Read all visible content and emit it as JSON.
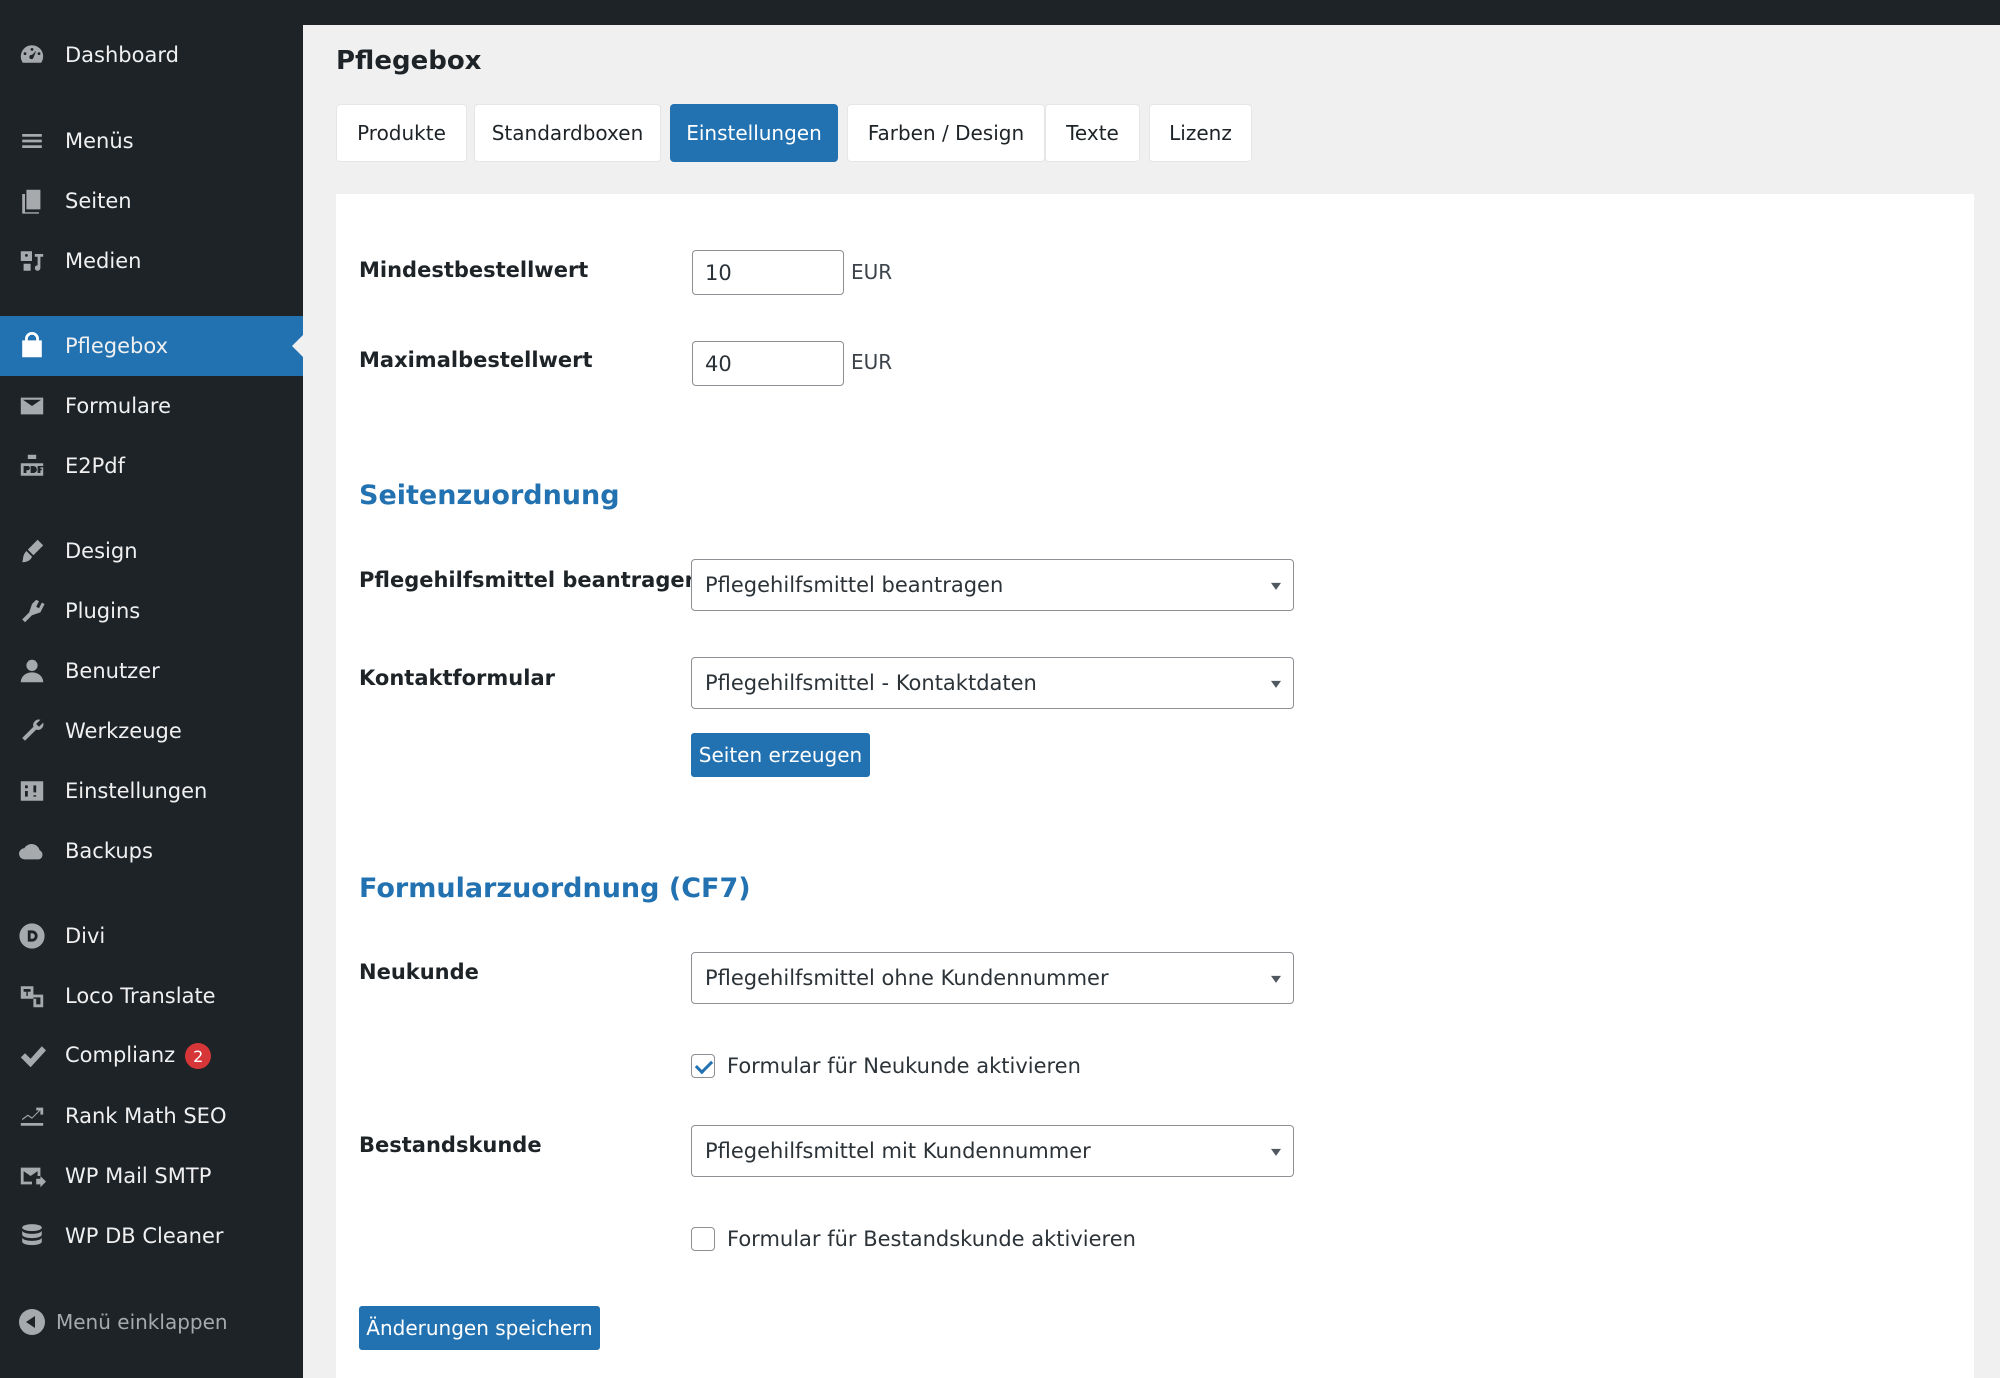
{
  "sidebar": {
    "items": [
      {
        "label": "Dashboard",
        "icon": "dashboard-icon"
      },
      {
        "label": "Menüs",
        "icon": "menu-icon"
      },
      {
        "label": "Seiten",
        "icon": "pages-icon"
      },
      {
        "label": "Medien",
        "icon": "media-icon"
      },
      {
        "label": "Pflegebox",
        "icon": "shopping-bag-icon",
        "active": true
      },
      {
        "label": "Formulare",
        "icon": "envelope-icon"
      },
      {
        "label": "E2Pdf",
        "icon": "e2pdf-icon"
      },
      {
        "label": "Design",
        "icon": "paintbrush-icon"
      },
      {
        "label": "Plugins",
        "icon": "plugins-icon"
      },
      {
        "label": "Benutzer",
        "icon": "user-icon"
      },
      {
        "label": "Werkzeuge",
        "icon": "wrench-icon"
      },
      {
        "label": "Einstellungen",
        "icon": "settings-icon"
      },
      {
        "label": "Backups",
        "icon": "cloud-icon"
      },
      {
        "label": "Divi",
        "icon": "divi-icon"
      },
      {
        "label": "Loco Translate",
        "icon": "translate-icon"
      },
      {
        "label": "Complianz",
        "icon": "checkmark-icon",
        "badge": "2"
      },
      {
        "label": "Rank Math SEO",
        "icon": "chart-icon"
      },
      {
        "label": "WP Mail SMTP",
        "icon": "mail-send-icon"
      },
      {
        "label": "WP DB Cleaner",
        "icon": "database-icon"
      }
    ],
    "collapse_label": "Menü einklappen"
  },
  "page": {
    "title": "Pflegebox"
  },
  "tabs": [
    {
      "label": "Produkte"
    },
    {
      "label": "Standardboxen"
    },
    {
      "label": "Einstellungen",
      "active": true
    },
    {
      "label": "Farben / Design"
    },
    {
      "label": "Texte"
    },
    {
      "label": "Lizenz"
    }
  ],
  "settings": {
    "min_order": {
      "label": "Mindestbestellwert",
      "value": "10",
      "unit": "EUR"
    },
    "max_order": {
      "label": "Maximalbestellwert",
      "value": "40",
      "unit": "EUR"
    },
    "page_mapping": {
      "title": "Seitenzuordnung",
      "request": {
        "label": "Pflegehilfsmittel beantragen",
        "selected": "Pflegehilfsmittel beantragen"
      },
      "contact": {
        "label": "Kontaktformular",
        "selected": "Pflegehilfsmittel - Kontaktdaten"
      },
      "generate_button": "Seiten erzeugen"
    },
    "form_mapping": {
      "title": "Formularzuordnung (CF7)",
      "new_customer": {
        "label": "Neukunde",
        "selected": "Pflegehilfsmittel ohne Kundennummer",
        "checkbox_label": "Formular für Neukunde aktivieren",
        "checked": true
      },
      "existing_customer": {
        "label": "Bestandskunde",
        "selected": "Pflegehilfsmittel mit Kundennummer",
        "checkbox_label": "Formular für Bestandskunde aktivieren",
        "checked": false
      }
    },
    "save_button": "Änderungen speichern"
  },
  "colors": {
    "accent": "#2271b1",
    "sidebar_bg": "#1d2327",
    "badge": "#d63638"
  }
}
